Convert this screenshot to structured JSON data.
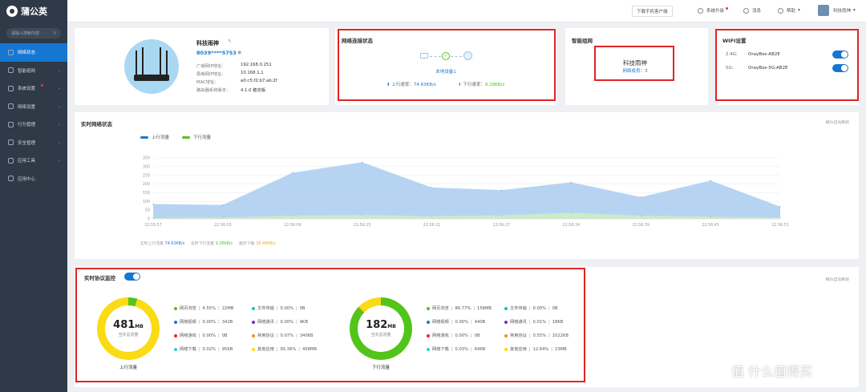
{
  "app": {
    "name": "蒲公英"
  },
  "sidebar": {
    "search_placeholder": "请输入搜索内容",
    "items": [
      {
        "label": "网络状态",
        "active": true
      },
      {
        "label": "智能组网",
        "active": false
      },
      {
        "label": "系统设置",
        "active": false,
        "badge": true
      },
      {
        "label": "网络设置",
        "active": false
      },
      {
        "label": "行为管理",
        "active": false
      },
      {
        "label": "安全管理",
        "active": false
      },
      {
        "label": "应用工具",
        "active": false
      },
      {
        "label": "应用中心",
        "active": false
      }
    ]
  },
  "topbar": {
    "download": "下载手机客户端",
    "upgrade": "系统升级",
    "messages": "消息",
    "help": "帮助",
    "user": "科技雨神"
  },
  "device": {
    "name": "科技雨神",
    "sn": "8039****5753",
    "fields": [
      {
        "key": "广域网IP地址：",
        "value": "192.168.0.251"
      },
      {
        "key": "局域网IP地址：",
        "value": "10.168.1.1"
      },
      {
        "key": "MAC地址：",
        "value": "a0:c5:f2:b7:ab:2f"
      },
      {
        "key": "路由器系统版本：",
        "value": "4.1.0 稳定版"
      }
    ]
  },
  "net": {
    "title": "网络连接状态",
    "local_device": "本地设备1",
    "up_label": "上行速率：",
    "up_value": "74.63KB/s",
    "down_label": "下行速率：",
    "down_value": "9.28KB/s"
  },
  "mesh": {
    "title": "智能组网",
    "name": "科技雨神",
    "members_label": "网络成员：",
    "members": "3"
  },
  "wifi": {
    "title": "WIFI设置",
    "bands": [
      {
        "band": "2.4G:",
        "ssid": "OrayBox-AB2E",
        "on": true
      },
      {
        "band": "5G:",
        "ssid": "OrayBox-5G-AB2E",
        "on": true
      }
    ]
  },
  "realtime": {
    "title": "实时网络状态",
    "more": "每5s自动刷新",
    "legend_up": "上行流量",
    "legend_down": "下行流量",
    "footer": [
      {
        "label": "实时上行流量",
        "value": "74.63KB/s",
        "color": "#1677d2"
      },
      {
        "label": "实时下行流量",
        "value": "9.28KB/s",
        "color": "#52c41a"
      },
      {
        "label": "额外下载",
        "value": "36.46KB/s",
        "color": "#f5a623"
      }
    ]
  },
  "chart_data": {
    "type": "area",
    "x": [
      "22:55:57",
      "22:56:03",
      "22:56:09",
      "22:56:15",
      "22:56:21",
      "22:56:27",
      "22:56:34",
      "22:56:39",
      "22:56:45",
      "22:56:51"
    ],
    "ylim": [
      0,
      350
    ],
    "yticks": [
      "350",
      "300",
      "250",
      "200",
      "150",
      "100",
      "50",
      "0"
    ],
    "legend_position": "top-left",
    "series": [
      {
        "name": "上行流量",
        "color": "#1677d2",
        "fill": "#a9cdf0",
        "values": [
          85,
          80,
          265,
          325,
          180,
          165,
          210,
          125,
          220,
          70
        ]
      },
      {
        "name": "下行流量",
        "color": "#52c41a",
        "fill": "#cfeec2",
        "values": [
          5,
          8,
          18,
          22,
          15,
          20,
          35,
          18,
          12,
          8
        ]
      }
    ]
  },
  "protocol": {
    "title": "实时协议监控",
    "enabled": true,
    "more": "每5s自动刷新",
    "up": {
      "value": "481",
      "unit": "MB",
      "sub": "当天总流量",
      "label": "上行流量",
      "items": [
        {
          "name": "网页浏览",
          "pct": "4.55%",
          "size": "22MB",
          "color": "#52c41a"
        },
        {
          "name": "文件传输",
          "pct": "0.00%",
          "size": "0B",
          "color": "#13c2c2"
        },
        {
          "name": "网络视频",
          "pct": "0.00%",
          "size": "342B",
          "color": "#1677d2"
        },
        {
          "name": "网络通讯",
          "pct": "0.00%",
          "size": "9KB",
          "color": "#722ed1"
        },
        {
          "name": "网络游戏",
          "pct": "0.00%",
          "size": "0B",
          "color": "#f5222d"
        },
        {
          "name": "常用协议",
          "pct": "0.07%",
          "size": "340KB",
          "color": "#fa8c16"
        },
        {
          "name": "网络下载",
          "pct": "0.02%",
          "size": "95KB",
          "color": "#36cfc9"
        },
        {
          "name": "其他应用",
          "pct": "95.36%",
          "size": "458MB",
          "color": "#fadb14"
        }
      ]
    },
    "down": {
      "value": "182",
      "unit": "MB",
      "sub": "当天总流量",
      "label": "下行流量",
      "items": [
        {
          "name": "网页浏览",
          "pct": "86.77%",
          "size": "158MB",
          "color": "#52c41a"
        },
        {
          "name": "文件传输",
          "pct": "0.00%",
          "size": "0B",
          "color": "#13c2c2"
        },
        {
          "name": "网络视频",
          "pct": "0.00%",
          "size": "440B",
          "color": "#1677d2"
        },
        {
          "name": "网络通讯",
          "pct": "0.01%",
          "size": "18KB",
          "color": "#722ed1"
        },
        {
          "name": "网络游戏",
          "pct": "0.00%",
          "size": "0B",
          "color": "#f5222d"
        },
        {
          "name": "常用协议",
          "pct": "0.55%",
          "size": "1022KB",
          "color": "#fa8c16"
        },
        {
          "name": "网络下载",
          "pct": "0.03%",
          "size": "64KB",
          "color": "#36cfc9"
        },
        {
          "name": "其他应用",
          "pct": "12.64%",
          "size": "23MB",
          "color": "#fadb14"
        }
      ]
    }
  },
  "watermark": "值 什么值得买"
}
